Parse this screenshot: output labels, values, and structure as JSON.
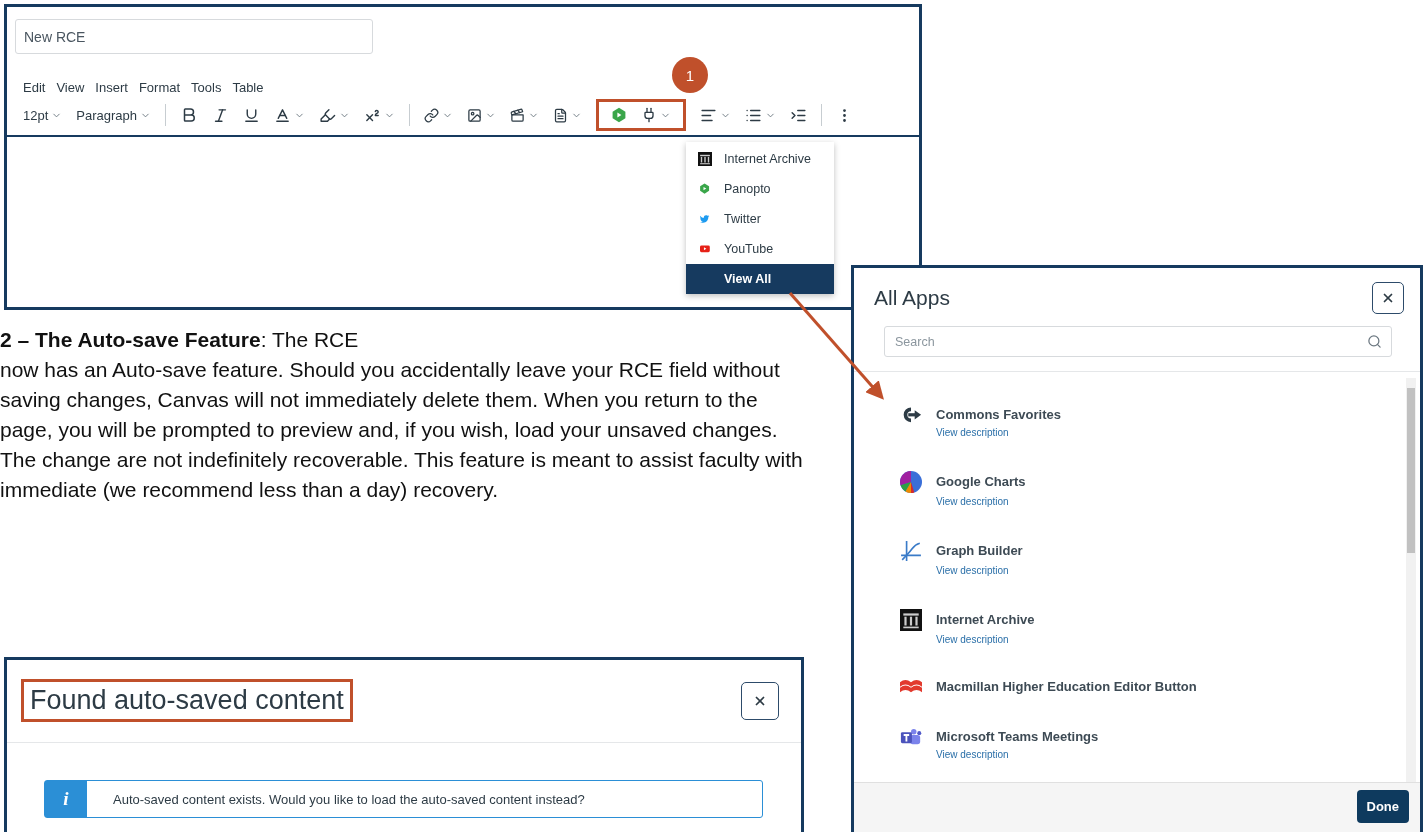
{
  "editor": {
    "title_field": {
      "value": "New RCE"
    },
    "menu": [
      "Edit",
      "View",
      "Insert",
      "Format",
      "Tools",
      "Table"
    ],
    "font_size": "12pt",
    "block_format": "Paragraph",
    "callout_badge": "1",
    "apps_menu": [
      {
        "label": "Internet Archive",
        "kind": "archive",
        "selected": false
      },
      {
        "label": "Panopto",
        "kind": "panopto",
        "selected": false
      },
      {
        "label": "Twitter",
        "kind": "twitter",
        "selected": false
      },
      {
        "label": "YouTube",
        "kind": "youtube",
        "selected": false
      },
      {
        "label": "View All",
        "kind": "none",
        "selected": true
      }
    ]
  },
  "paragraph": {
    "text": "**2 – The Auto-save Feature**: The RCE\nnow has an Auto-save feature. Should you accidentally leave your RCE field without saving changes, Canvas will not immediately delete them. When you return to the page, you will be prompted to preview and, if you wish, load your unsaved changes. The change are not indefinitely recoverable. This feature is meant to assist faculty with immediate (we recommend less than a day) recovery."
  },
  "all_apps": {
    "title": "All Apps",
    "search": {
      "placeholder": "Search"
    },
    "apps": [
      {
        "name": "Commons Favorites",
        "kind": "commons",
        "link": "View description"
      },
      {
        "name": "Google Charts",
        "kind": "charts",
        "link": "View description"
      },
      {
        "name": "Graph Builder",
        "kind": "graph",
        "link": "View description"
      },
      {
        "name": "Internet Archive",
        "kind": "archive",
        "link": "View description"
      },
      {
        "name": "Macmillan Higher Education Editor Button",
        "kind": "macmillan"
      },
      {
        "name": "Microsoft Teams Meetings",
        "kind": "teams",
        "link": "View description"
      }
    ],
    "done": "Done"
  },
  "autosave_dialog": {
    "title": "Found auto-saved content",
    "alert_icon": "i",
    "alert": "Auto-saved content exists. Would you like to load the auto-saved content instead?"
  }
}
